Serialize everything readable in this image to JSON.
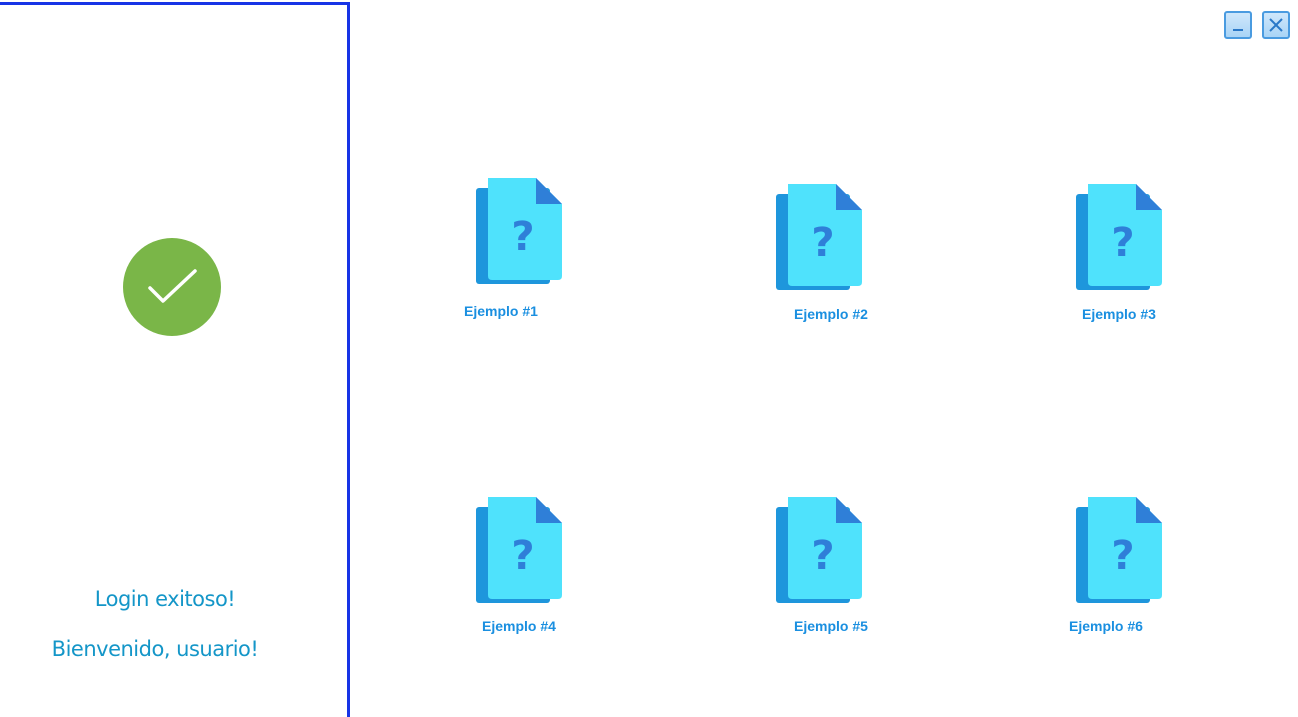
{
  "window_controls": {
    "minimize_icon": "minimize-icon",
    "close_icon": "close-icon"
  },
  "login_panel": {
    "status_icon": "checkmark-circle-icon",
    "title": "Login exitoso!",
    "welcome": "Bienvenido, usuario!"
  },
  "files": [
    {
      "label": "Ejemplo #1",
      "icon": "unknown-file-icon"
    },
    {
      "label": "Ejemplo #2",
      "icon": "unknown-file-icon"
    },
    {
      "label": "Ejemplo #3",
      "icon": "unknown-file-icon"
    },
    {
      "label": "Ejemplo #4",
      "icon": "unknown-file-icon"
    },
    {
      "label": "Ejemplo #5",
      "icon": "unknown-file-icon"
    },
    {
      "label": "Ejemplo #6",
      "icon": "unknown-file-icon"
    }
  ],
  "colors": {
    "panel_border": "#1734e6",
    "accent_text": "#1496c8",
    "file_label": "#1a8fe0",
    "success_green": "#7ab648"
  }
}
